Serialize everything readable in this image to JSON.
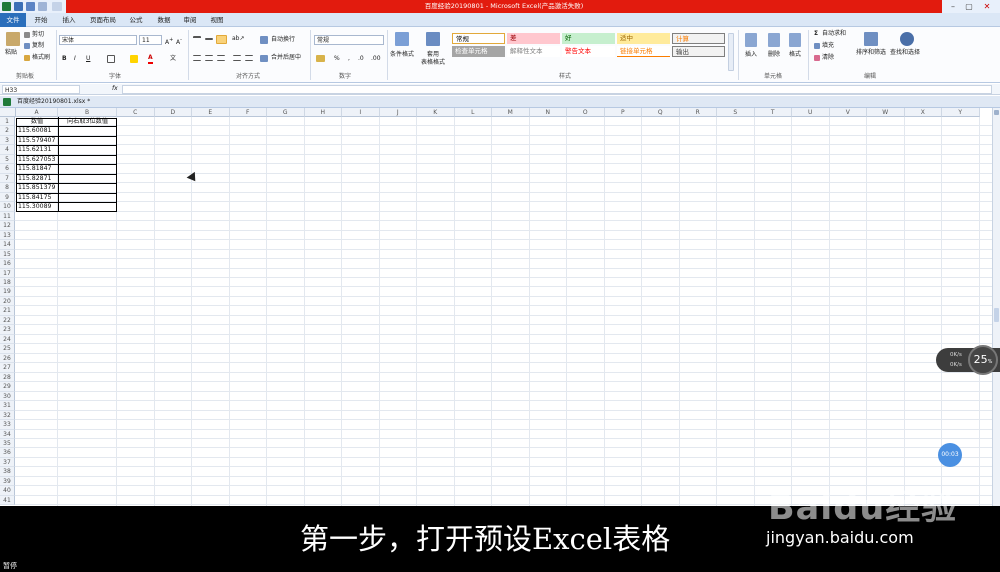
{
  "app": {
    "window_title": "百度经验20190801 - Microsoft Excel(产品激活失败)"
  },
  "menu": {
    "file": "文件",
    "tabs": [
      "开始",
      "插入",
      "页面布局",
      "公式",
      "数据",
      "审阅",
      "视图"
    ]
  },
  "ribbon": {
    "clipboard": {
      "paste": "粘贴",
      "cut": "剪切",
      "copy": "复制",
      "format_painter": "格式刷",
      "label": "剪贴板"
    },
    "font": {
      "name": "宋体",
      "size": "11",
      "bold": "B",
      "italic": "I",
      "underline": "U",
      "label": "字体"
    },
    "alignment": {
      "wrap": "自动换行",
      "merge": "合并后居中",
      "label": "对齐方式"
    },
    "number": {
      "format": "常规",
      "percent": "%",
      "comma": ",",
      "label": "数字"
    },
    "styles": {
      "conditional": "条件格式",
      "table_format": "套用\n表格格式",
      "cells": [
        {
          "text": "常规",
          "bg": "#ffffff",
          "color": "#000000"
        },
        {
          "text": "差",
          "bg": "#ffc7ce",
          "color": "#9c0006"
        },
        {
          "text": "好",
          "bg": "#c6efce",
          "color": "#006100"
        },
        {
          "text": "适中",
          "bg": "#ffeb9c",
          "color": "#9c6500"
        },
        {
          "text": "计算",
          "bg": "#f2f2f2",
          "color": "#fa7d00"
        },
        {
          "text": "检查单元格",
          "bg": "#a5a5a5",
          "color": "#ffffff"
        },
        {
          "text": "解释性文本",
          "bg": "#ffffff",
          "color": "#7f7f7f"
        },
        {
          "text": "警告文本",
          "bg": "#ffffff",
          "color": "#ff0000"
        },
        {
          "text": "链接单元格",
          "bg": "#ffffff",
          "color": "#fa7d00"
        },
        {
          "text": "输出",
          "bg": "#f2f2f2",
          "color": "#3f3f3f"
        }
      ],
      "label": "样式"
    },
    "cells": {
      "insert": "插入",
      "delete": "删除",
      "format": "格式",
      "label": "单元格"
    },
    "editing": {
      "autosum": "自动求和",
      "fill": "填充",
      "clear": "清除",
      "sort": "排序和筛选",
      "find": "查找和选择",
      "label": "编辑"
    }
  },
  "formula_bar": {
    "name_box": "H33",
    "fx": "fx",
    "content": ""
  },
  "doc_tab": {
    "name": "百度经验20190801.xlsx",
    "modified": "*"
  },
  "sheet": {
    "columns": [
      "A",
      "B",
      "C",
      "D",
      "E",
      "F",
      "G",
      "H",
      "I",
      "J",
      "K",
      "L",
      "M",
      "N",
      "O",
      "P",
      "Q",
      "R",
      "S",
      "T",
      "U",
      "V",
      "W",
      "X",
      "Y"
    ],
    "rows": [
      "1",
      "2",
      "3",
      "4",
      "5",
      "6",
      "7",
      "8",
      "9",
      "10",
      "11",
      "12",
      "13",
      "14",
      "15",
      "16",
      "17",
      "18",
      "19",
      "20",
      "21",
      "22",
      "23",
      "24",
      "25",
      "26",
      "27",
      "28",
      "29",
      "30",
      "31",
      "32",
      "33",
      "34",
      "35",
      "36",
      "37",
      "38",
      "39",
      "40",
      "41"
    ],
    "header_a": "数值",
    "header_b": "向右取3位数值",
    "values": [
      "115.60081",
      "115.579407",
      "115.62131",
      "115.627053",
      "115.81847",
      "115.82871",
      "115.851379",
      "115.84175",
      "115.30089"
    ]
  },
  "overlay": {
    "subtitle": "第一步，打开预设Excel表格",
    "watermark_logo": "Baidu经验",
    "watermark_url": "jingyan.baidu.com",
    "paused": "暂停",
    "speed_up": "0K/s",
    "speed_down": "0K/s",
    "speed_percent": "25",
    "speed_unit": "%",
    "timer": "00:03"
  }
}
